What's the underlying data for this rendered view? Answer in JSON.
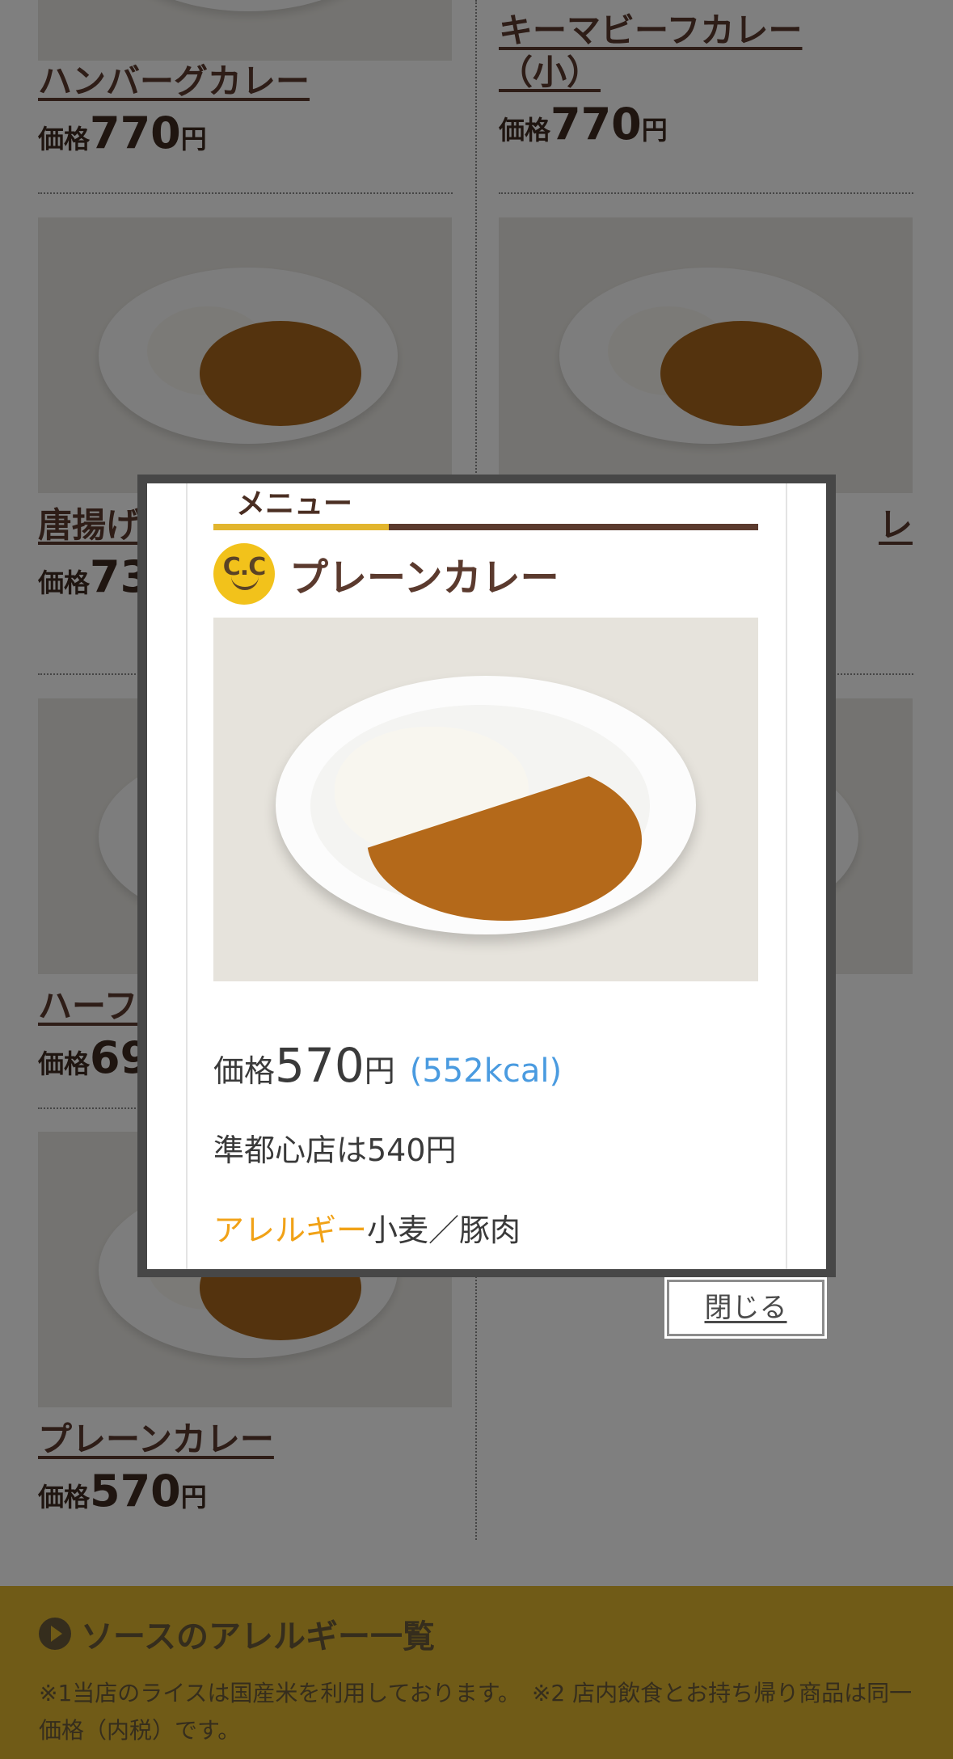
{
  "background": {
    "cards": [
      {
        "name": "ハンバーグカレー",
        "price_label": "価格",
        "price": "770",
        "yen": "円"
      },
      {
        "name": "キーマビーフカレー（小）",
        "price_label": "価格",
        "price": "770",
        "yen": "円"
      },
      {
        "name": "唐揚げ",
        "price_label": "価格",
        "price": "73",
        "yen": ""
      },
      {
        "name": "レ",
        "price_label": "",
        "price": "",
        "yen": ""
      },
      {
        "name": "ハーフ",
        "price_label": "価格",
        "price": "69",
        "yen": ""
      },
      {
        "name": "プレーンカレー",
        "price_label": "価格",
        "price": "570",
        "yen": "円"
      }
    ],
    "footer": {
      "title": "ソースのアレルギー一覧",
      "note": "※1当店のライスは国産米を利用しております。　※2 店内飲食とお持ち帰り商品は同一価格（内税）です。"
    }
  },
  "modal": {
    "section_tab": "メニュー",
    "logo_text": "C.C",
    "title": "プレーンカレー",
    "price_label": "価格",
    "price": "570",
    "yen": "円",
    "kcal": "(552kcal)",
    "alt_price": "準都心店は540円",
    "allergy_label": "アレルギー",
    "allergy_value": "小麦／豚肉",
    "close_label": "閉じる"
  },
  "colors": {
    "brand_brown": "#5b3a2e",
    "accent_yellow": "#e2b52e",
    "kcal_blue": "#4a9be0",
    "allergy_orange": "#f1a217"
  }
}
